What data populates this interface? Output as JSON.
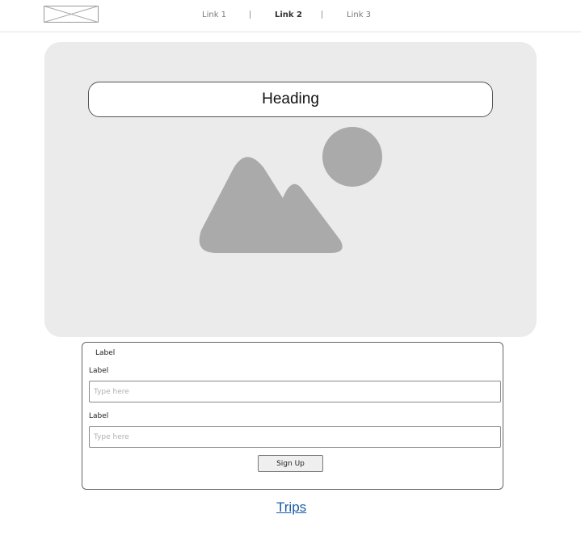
{
  "nav": {
    "links": [
      {
        "label": "Link 1"
      },
      {
        "label": "Link 2"
      },
      {
        "label": "Link 3"
      }
    ],
    "active_link": "Link 2"
  },
  "hero": {
    "heading": "Heading"
  },
  "form": {
    "legend": "Label",
    "fields": [
      {
        "label": "Label",
        "placeholder": "Type here",
        "value": ""
      },
      {
        "label": "Label",
        "placeholder": "Type here",
        "value": ""
      }
    ],
    "submit_label": "Sign Up"
  },
  "footer": {
    "link_label": "Trips",
    "link_color": "#1a5fa8"
  },
  "icons": {
    "logo": "logo-placeholder-icon",
    "hero_image": "image-placeholder-icon"
  }
}
